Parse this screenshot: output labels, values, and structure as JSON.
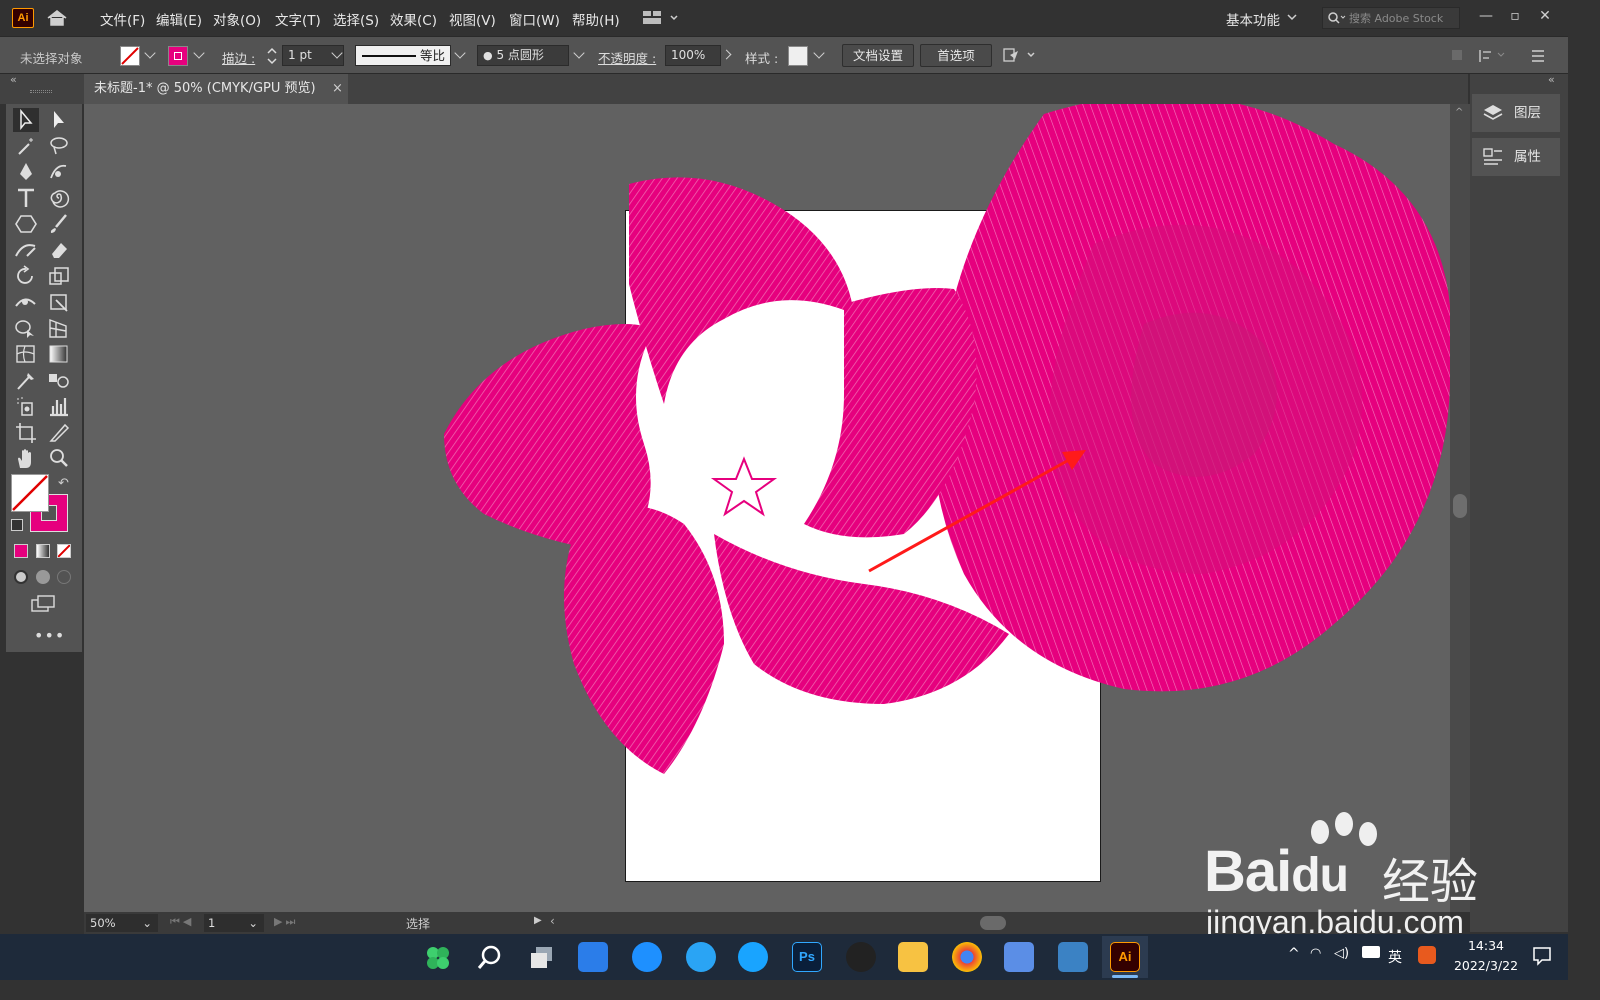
{
  "app": {
    "logo": "Ai"
  },
  "menu": [
    "文件(F)",
    "编辑(E)",
    "对象(O)",
    "文字(T)",
    "选择(S)",
    "效果(C)",
    "视图(V)",
    "窗口(W)",
    "帮助(H)"
  ],
  "workspace": "基本功能",
  "search": {
    "placeholder": "搜索 Adobe Stock"
  },
  "control": {
    "selection": "未选择对象",
    "stroke_label": "描边 :",
    "stroke_weight": "1 pt",
    "profile": "等比",
    "brush": "5 点圆形",
    "opacity_label": "不透明度 :",
    "opacity": "100%",
    "style_label": "样式 :",
    "doc_setup": "文档设置",
    "prefs": "首选项"
  },
  "tab": {
    "title": "未标题-1* @ 50% (CMYK/GPU 预览)",
    "close": "×"
  },
  "panels": [
    "图层",
    "属性"
  ],
  "status": {
    "zoom": "50%",
    "artboard": "1",
    "tool": "选择"
  },
  "taskbar": {
    "time": "14:34",
    "date": "2022/3/22",
    "ime": "英"
  },
  "watermark": {
    "brand": "Bai",
    "brand2": "du",
    "cn": "经验",
    "url": "jingyan.baidu.com"
  },
  "colors": {
    "accent": "#e6007e",
    "arrow": "#ff1a1a"
  }
}
